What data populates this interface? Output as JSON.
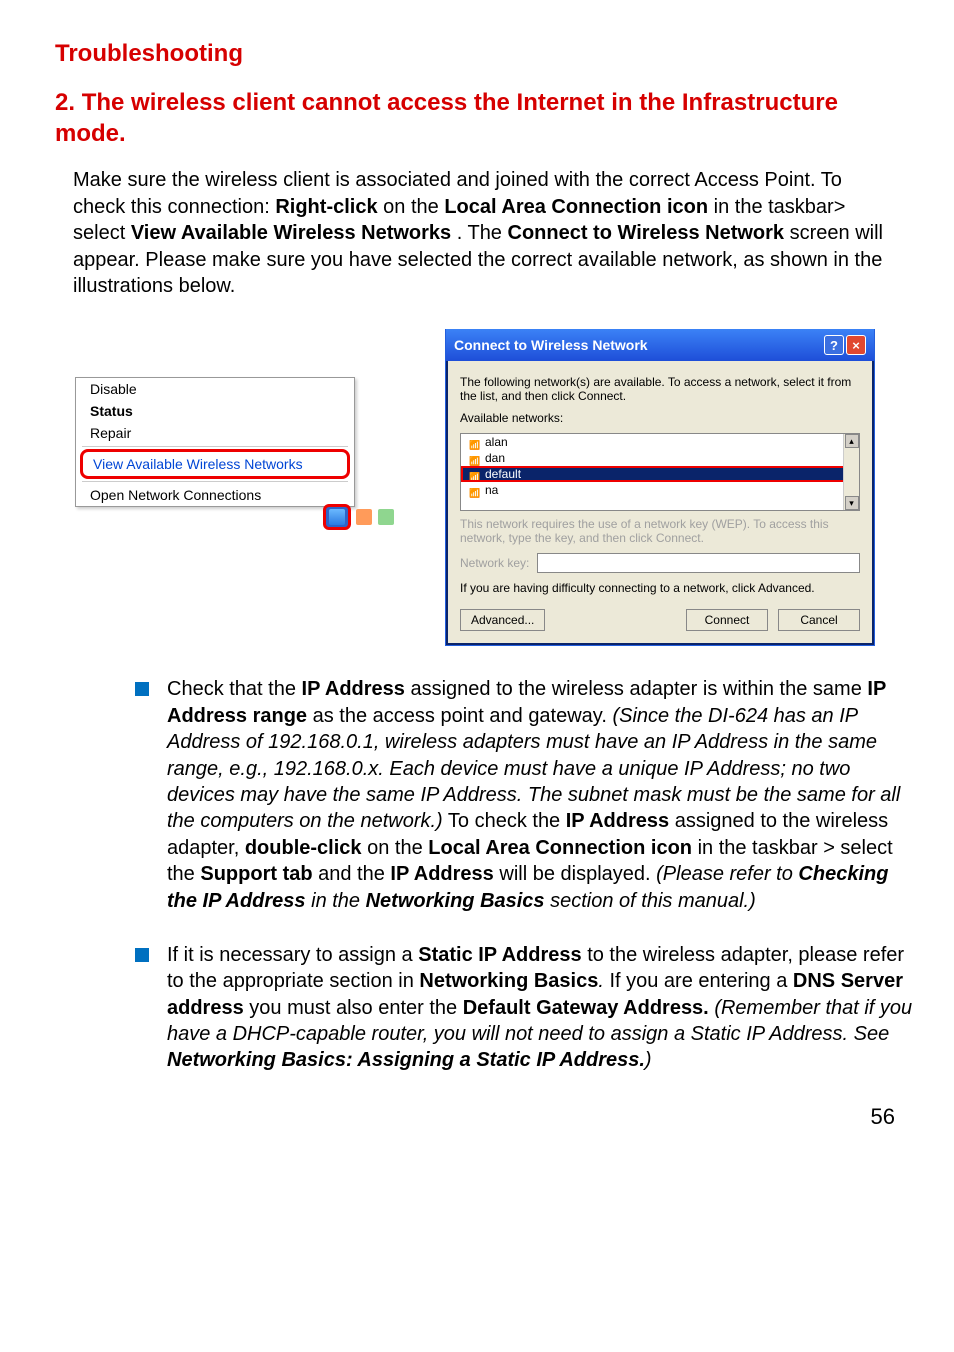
{
  "heading1": "Troubleshooting",
  "heading2_num": "2.",
  "heading2_text": "The wireless client cannot access the Internet in the Infrastructure mode.",
  "intro": {
    "t1": "Make sure the wireless client is associated and joined with the correct Access Point. To check this connection: ",
    "b1": "Right-click",
    "t2": " on the ",
    "b2": "Local Area Connection icon",
    "t3": " in the taskbar> select ",
    "b3": "View Available Wireless Networks",
    "t4": ". The ",
    "b4": "Connect to Wireless Network",
    "t5": " screen will appear.  Please make sure you have selected the correct available network, as shown in the illustrations below."
  },
  "contextmenu": {
    "items": [
      "Disable",
      "Status",
      "Repair"
    ],
    "highlight": "View Available Wireless Networks",
    "last": "Open Network Connections"
  },
  "dialog": {
    "title": "Connect to Wireless Network",
    "descr": "The following network(s) are available. To access a network, select it from the list, and then click Connect.",
    "availlabel": "Available networks:",
    "networks": [
      "alan",
      "dan",
      "default",
      "na"
    ],
    "wep": "This network requires the use of a network key (WEP). To access this network, type the key, and then click Connect.",
    "keylabel": "Network key:",
    "difficulty": "If you are having difficulty connecting to a network, click Advanced.",
    "advanced": "Advanced...",
    "connect": "Connect",
    "cancel": "Cancel"
  },
  "bullet1": {
    "t1": "Check that the ",
    "b1": "IP Address",
    "t2": " assigned to the wireless adapter is within the same ",
    "b2": "IP Address range",
    "t3": " as the access point and gateway. ",
    "i1": "(Since the DI-624 has an IP Address of 192.168.0.1, wireless adapters must have an IP Address in the same range, e.g., 192.168.0.x.  Each device must have a unique IP Address; no two devices may have the same IP Address. The subnet mask must be the same for all the computers on the network.)",
    "t4": " To check the ",
    "b3": "IP Address",
    "t5": " assigned to the wireless adapter, ",
    "b4": "double-click",
    "t6": " on the ",
    "b5": "Local Area Connection icon",
    "t7": " in the taskbar > select the ",
    "b6": "Support tab",
    "t8": " and the ",
    "b7": "IP Address",
    "t9": " will be displayed. ",
    "i2a": "(Please refer to ",
    "bi1": "Checking the IP Address",
    "i2b": " in the ",
    "bi2": "Networking Basics",
    "i2c": " section of this manual.)"
  },
  "bullet2": {
    "t1": "If it is necessary to assign a ",
    "b1": "Static IP Address",
    "t2": " to the wireless adapter, please refer to the appropriate section in ",
    "b2": "Networking Basics",
    "i1": ".",
    "t3": " If you are entering a ",
    "b3": "DNS Server address",
    "t4": " you must also enter the ",
    "b4": "Default Gateway Address.",
    "t5": " ",
    "i2a": "(Remember that if you have a DHCP-capable router, you will not need to assign a Static IP Address.  See  ",
    "bi1": "Networking Basics: Assigning a Static IP Address.",
    "i2b": ")"
  },
  "pagenum": "56"
}
